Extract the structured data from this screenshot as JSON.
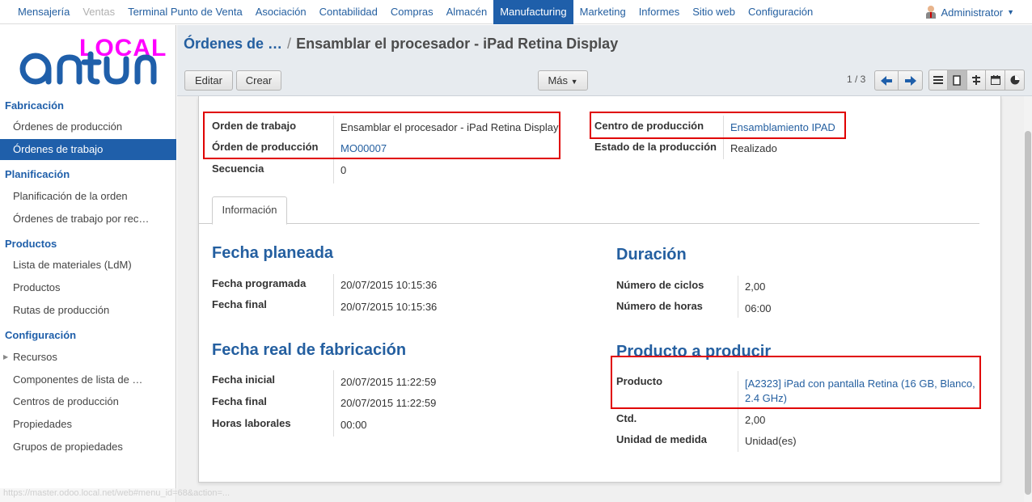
{
  "topmenu": [
    "Mensajería",
    "Ventas",
    "Terminal Punto de Venta",
    "Asociación",
    "Contabilidad",
    "Compras",
    "Almacén",
    "Manufacturing",
    "Marketing",
    "Informes",
    "Sitio web",
    "Configuración"
  ],
  "user": {
    "name": "Administrator"
  },
  "logo": {
    "overlay_text": "LOCAL",
    "brand": "antun"
  },
  "sidebar": {
    "sections": [
      {
        "title": "Fabricación",
        "items": [
          "Órdenes de producción",
          "Órdenes de trabajo"
        ]
      },
      {
        "title": "Planificación",
        "items": [
          "Planificación de la orden",
          "Órdenes de trabajo por rec…"
        ]
      },
      {
        "title": "Productos",
        "items": [
          "Lista de materiales (LdM)",
          "Productos",
          "Rutas de producción"
        ]
      },
      {
        "title": "Configuración",
        "items": [
          "Recursos",
          "Componentes de lista de …",
          "Centros de producción",
          "Propiedades",
          "Grupos de propiedades"
        ]
      }
    ],
    "active_item": "Órdenes de trabajo"
  },
  "breadcrumb": {
    "parent": "Órdenes de …",
    "separator": "/",
    "current": "Ensamblar el procesador - iPad Retina Display"
  },
  "buttons": {
    "edit": "Editar",
    "create": "Crear",
    "more": "Más"
  },
  "pager": {
    "text": "1 / 3"
  },
  "form": {
    "orden_trabajo_label": "Orden de trabajo",
    "orden_trabajo_value": "Ensamblar el procesador - iPad Retina Display",
    "orden_produccion_label": "Órden de producción",
    "orden_produccion_value": "MO00007",
    "secuencia_label": "Secuencia",
    "secuencia_value": "0",
    "centro_label": "Centro de producción",
    "centro_value": "Ensamblamiento IPAD",
    "estado_label": "Estado de la producción",
    "estado_value": "Realizado"
  },
  "tab": {
    "label": "Información"
  },
  "fecha_planeada": {
    "title": "Fecha planeada",
    "programada_label": "Fecha programada",
    "programada_value": "20/07/2015 10:15:36",
    "final_label": "Fecha final",
    "final_value": "20/07/2015 10:15:36"
  },
  "fecha_real": {
    "title": "Fecha real de fabricación",
    "inicial_label": "Fecha inicial",
    "inicial_value": "20/07/2015 11:22:59",
    "final_label": "Fecha final",
    "final_value": "20/07/2015 11:22:59",
    "horas_label": "Horas laborales",
    "horas_value": "00:00"
  },
  "duracion": {
    "title": "Duración",
    "ciclos_label": "Número de ciclos",
    "ciclos_value": "2,00",
    "horas_label": "Número de horas",
    "horas_value": "06:00"
  },
  "producto": {
    "title": "Producto a producir",
    "producto_label": "Producto",
    "producto_value_1": "[A2323] iPad con pantalla Retina (16 GB, Blanco,",
    "producto_value_2": "2.4 GHz)",
    "ctd_label": "Ctd.",
    "ctd_value": "2,00",
    "unidad_label": "Unidad de medida",
    "unidad_value": "Unidad(es)"
  },
  "statusbar": {
    "url": "https://master.odoo.local.net/web#menu_id=68&action=..."
  },
  "colors": {
    "accent": "#1f5faa",
    "highlight": "#e00000",
    "logo_overlay": "#ff00ff"
  }
}
